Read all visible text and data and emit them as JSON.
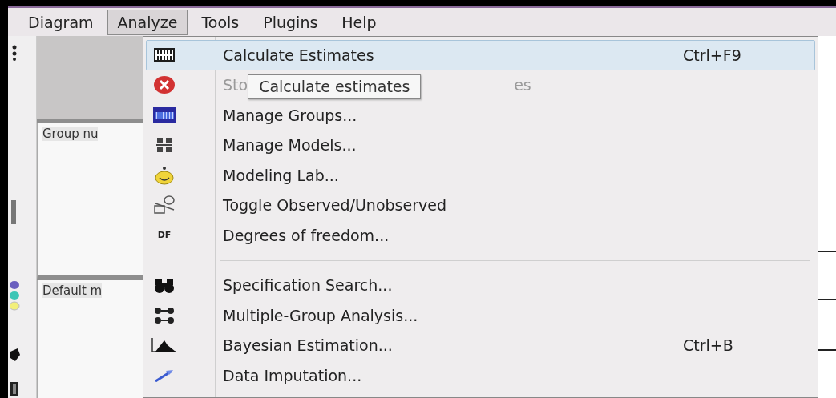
{
  "menu_bar": [
    {
      "label": "Diagram",
      "selected": false
    },
    {
      "label": "Analyze",
      "selected": true
    },
    {
      "label": "Tools",
      "selected": false
    },
    {
      "label": "Plugins",
      "selected": false
    },
    {
      "label": "Help",
      "selected": false
    }
  ],
  "panels": [
    {
      "header": "Group nu"
    },
    {
      "header": "Default m"
    }
  ],
  "menu": {
    "items": [
      {
        "kind": "item",
        "label": "Calculate Estimates",
        "shortcut": "Ctrl+F9",
        "selected": true,
        "disabled": false
      },
      {
        "kind": "covered",
        "label_parts": [
          "Sto",
          "es"
        ],
        "selected": false,
        "disabled": true
      },
      {
        "kind": "item",
        "label": "Manage Groups...",
        "selected": false,
        "disabled": false
      },
      {
        "kind": "item",
        "label": "Manage Models...",
        "selected": false,
        "disabled": false
      },
      {
        "kind": "item",
        "label": "Modeling Lab...",
        "selected": false,
        "disabled": false
      },
      {
        "kind": "item",
        "label": "Toggle Observed/Unobserved",
        "selected": false,
        "disabled": false
      },
      {
        "kind": "item",
        "label": "Degrees of freedom...",
        "icon_text": "DF",
        "selected": false,
        "disabled": false
      },
      {
        "kind": "separator"
      },
      {
        "kind": "item",
        "label": "Specification Search...",
        "selected": false,
        "disabled": false
      },
      {
        "kind": "item",
        "label": "Multiple-Group Analysis...",
        "selected": false,
        "disabled": false
      },
      {
        "kind": "item",
        "label": "Bayesian Estimation...",
        "shortcut": "Ctrl+B",
        "selected": false,
        "disabled": false
      },
      {
        "kind": "item",
        "label": "Data Imputation...",
        "selected": false,
        "disabled": false
      }
    ]
  },
  "tooltip": {
    "text": "Calculate estimates"
  }
}
